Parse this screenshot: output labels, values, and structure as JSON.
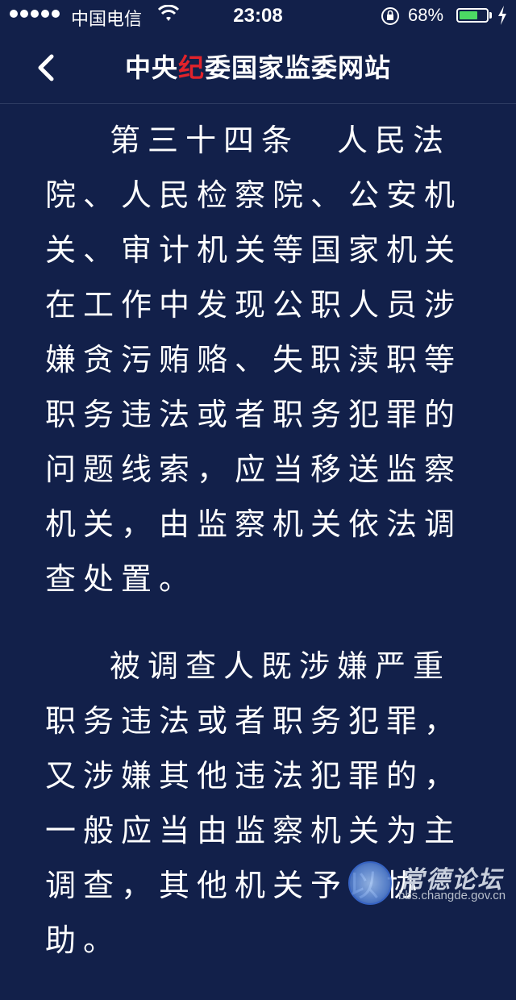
{
  "status_bar": {
    "carrier": "中国电信",
    "time": "23:08",
    "battery_percent": "68%",
    "battery_level": 0.68,
    "icons": [
      "signal-dots-icon",
      "wifi-icon",
      "orientation-lock-icon",
      "battery-icon",
      "charging-bolt-icon"
    ]
  },
  "nav": {
    "back_icon": "chevron-left-icon",
    "title_pre": "中央",
    "title_accent": "纪",
    "title_post": "委国家监委网站",
    "accent_color": "#e0232b"
  },
  "article": {
    "paragraphs": [
      "第三十四条　人民法院、人民检察院、公安机关、审计机关等国家机关在工作中发现公职人员涉嫌贪污贿赂、失职渎职等职务违法或者职务犯罪的问题线索，应当移送监察机关，由监察机关依法调查处置。",
      "被调查人既涉嫌严重职务违法或者职务犯罪，又涉嫌其他违法犯罪的，一般应当由监察机关为主调查，其他机关予以协助。"
    ]
  },
  "watermark": {
    "name": "常德论坛",
    "url": "bbs.changde.gov.cn"
  },
  "colors": {
    "background": "#12204a",
    "text": "#ffffff",
    "battery_fill": "#4cd964"
  }
}
